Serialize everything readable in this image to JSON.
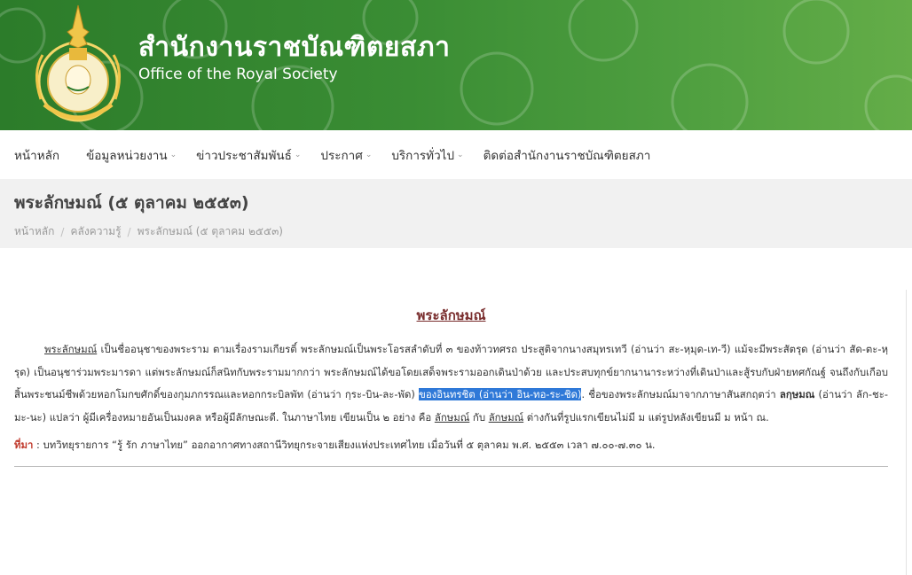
{
  "header": {
    "title": "สำนักงานราชบัณฑิตยสภา",
    "subtitle": "Office of the Royal Society",
    "emblem_text": "สำนักงานราชบัณฑิตยสภา"
  },
  "nav": {
    "items": [
      {
        "label": "หน้าหลัก",
        "has_dropdown": false
      },
      {
        "label": "ข้อมูลหน่วยงาน",
        "has_dropdown": true
      },
      {
        "label": "ข่าวประชาสัมพันธ์",
        "has_dropdown": true
      },
      {
        "label": "ประกาศ",
        "has_dropdown": true
      },
      {
        "label": "บริการทั่วไป",
        "has_dropdown": true
      },
      {
        "label": "ติดต่อสำนักงานราชบัณฑิตยสภา",
        "has_dropdown": false
      }
    ]
  },
  "page": {
    "title": "พระลักษมณ์ (๕ ตุลาคม ๒๕๕๓)",
    "breadcrumb": [
      "หน้าหลัก",
      "คลังความรู้",
      "พระลักษมณ์ (๕ ตุลาคม ๒๕๕๓)"
    ]
  },
  "article": {
    "heading": "พระลักษมณ์",
    "p_lead": "พระลักษมณ์",
    "p_text1": " เป็นชื่ออนุชาของพระราม ตามเรื่องรามเกียรติ์  พระลักษมณ์เป็นพระโอรสลำดับที่ ๓ ของท้าวทศรถ ประสูติจากนางสมุทรเทวี (อ่านว่า สะ-หฺมุด-เท-วี)  แม้จะมีพระสัตรุด (อ่านว่า สัด-ตะ-หฺรุด) เป็นอนุชาร่วมพระมารดา แต่พระลักษมณ์ก็สนิทกับพระรามมากกว่า พระลักษมณ์ได้ขอโดยเสด็จพระรามออกเดินป่าด้วย และประสบทุกข์ยากนานาระหว่างที่เดินป่าและสู้รบกับฝ่ายทศกัณฐ์ จนถึงกับเกือบสิ้นพระชนม์ชีพด้วยหอกโมกขศักดิ์ของกุมภกรรณและหอกกระบิลพัท (อ่านว่า กฺระ-บิน-ละ-พัด) ",
    "p_highlight": "ของอินทรชิต (อ่านว่า อิน-ทอ-ระ-ชิด)",
    "p_text2": ".  ชื่อของพระลักษมณ์มาจากภาษาสันสกฤตว่า ",
    "p_bold": "ลกฺษมณ",
    "p_text3": " (อ่านว่า ลัก-ชะ-มะ-นะ) แปลว่า ผู้มีเครื่องหมายอันเป็นมงคล หรือผู้มีลักษณะดี. ในภาษาไทย เขียนเป็น ๒ อย่าง คือ ",
    "p_u1": "ลักษมณ์",
    "p_text4": " กับ ",
    "p_u2": "ลักษมณ์",
    "p_text5": " ต่างกันที่รูปแรกเขียนไม่มี ม แต่รูปหลังเขียนมี ม หน้า ณ.",
    "source_label": "ที่มา",
    "source_colon": " :  ",
    "source_text": "บทวิทยุรายการ “รู้ รัก ภาษาไทย”  ออกอากาศทางสถานีวิทยุกระจายเสียงแห่งประเทศไทย เมื่อวันที่ ๕ ตุลาคม พ.ศ. ๒๕๕๓  เวลา ๗.๐๐-๗.๓๐ น."
  },
  "colors": {
    "header_green": "#3a8d34",
    "highlight": "#2f79d8",
    "heading_red": "#7a2e2e",
    "source_red": "#c0392b"
  }
}
